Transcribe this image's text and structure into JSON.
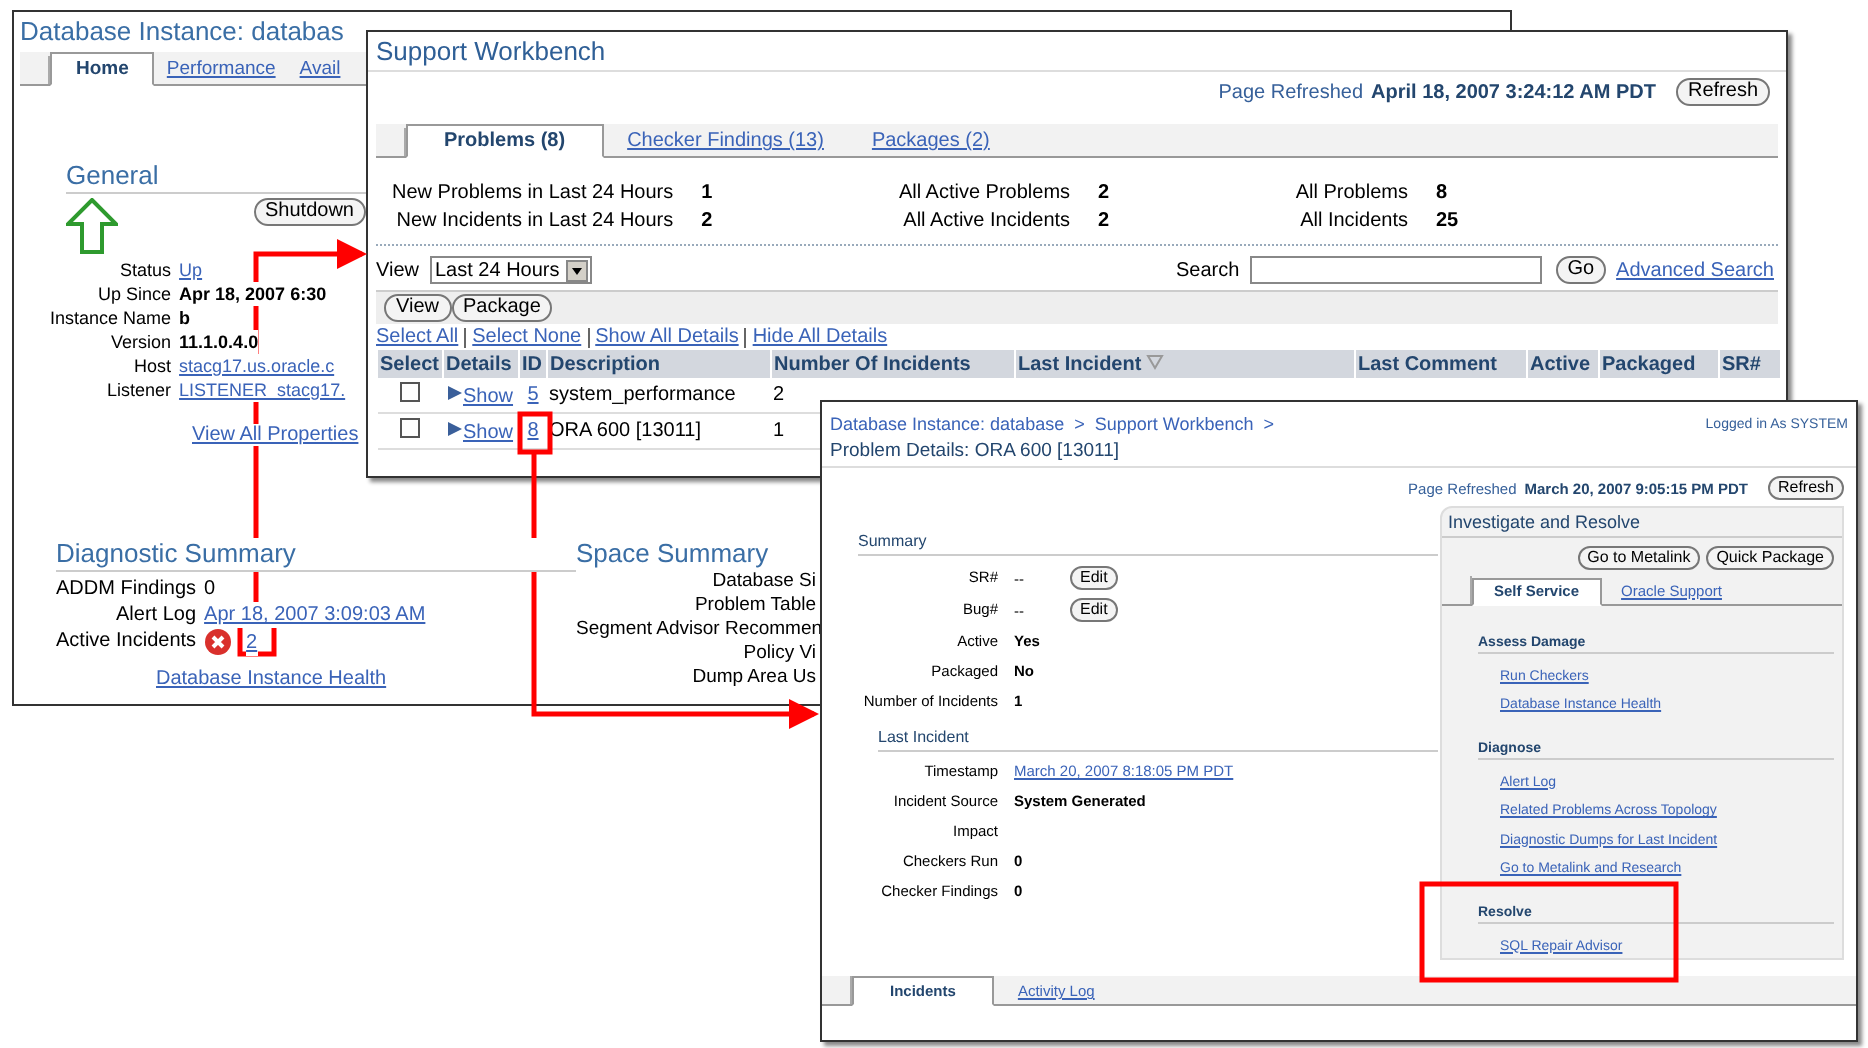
{
  "database_window": {
    "title": "Database Instance: databas",
    "tabs": [
      {
        "label": "Home",
        "selected": true
      },
      {
        "label": "Performance",
        "selected": false
      },
      {
        "label": "Avail",
        "selected": false
      }
    ],
    "general": {
      "heading": "General",
      "shutdown_button": "Shutdown",
      "properties": [
        {
          "label": "Status",
          "value": "Up",
          "kind": "link"
        },
        {
          "label": "Up Since",
          "value": "Apr 18, 2007 6:30",
          "kind": "bold"
        },
        {
          "label": "Instance Name",
          "value": "b",
          "kind": "bold"
        },
        {
          "label": "Version",
          "value": "11.1.0.4.0",
          "kind": "bold"
        },
        {
          "label": "Host",
          "value": "stacg17.us.oracle.c",
          "kind": "link"
        },
        {
          "label": "Listener",
          "value": "LISTENER_stacg17.",
          "kind": "link"
        }
      ],
      "view_all_link": "View All Properties"
    },
    "diagnostic_summary": {
      "heading": "Diagnostic Summary",
      "rows": [
        {
          "label": "ADDM Findings",
          "value": "0",
          "kind": "text",
          "error": false
        },
        {
          "label": "Alert Log",
          "value": "Apr 18, 2007 3:09:03 AM",
          "kind": "link",
          "error": false
        },
        {
          "label": "Active Incidents",
          "value": "2",
          "kind": "link",
          "error": true
        }
      ],
      "health_link": "Database Instance Health"
    },
    "space_summary": {
      "heading": "Space Summary",
      "labels": [
        "Database Si",
        "Problem Table",
        "Segment Advisor Recommen",
        "Policy Vi",
        "Dump Area Us"
      ]
    }
  },
  "workbench_window": {
    "title": "Support Workbench",
    "refreshed_label": "Page Refreshed",
    "refreshed_time": "April 18, 2007 3:24:12 AM PDT",
    "refresh_button": "Refresh",
    "tabs": [
      {
        "label": "Problems (8)",
        "selected": true
      },
      {
        "label": "Checker Findings (13)",
        "selected": false
      },
      {
        "label": "Packages (2)",
        "selected": false
      }
    ],
    "stats": [
      [
        {
          "label": "New Problems in Last 24 Hours",
          "value": "1"
        },
        {
          "label": "New Incidents in Last 24 Hours",
          "value": "2"
        }
      ],
      [
        {
          "label": "All Active Problems",
          "value": "2"
        },
        {
          "label": "All Active Incidents",
          "value": "2"
        }
      ],
      [
        {
          "label": "All Problems",
          "value": "8"
        },
        {
          "label": "All Incidents",
          "value": "25"
        }
      ]
    ],
    "view_label": "View",
    "view_select": "Last 24 Hours",
    "search_label": "Search",
    "go_button": "Go",
    "advanced_search_link": "Advanced Search",
    "action_buttons": [
      "View",
      "Package"
    ],
    "selection_links": [
      "Select All",
      "Select None",
      "Show All Details",
      "Hide All Details"
    ],
    "table": {
      "columns": [
        "Select",
        "Details",
        "ID",
        "Description",
        "Number Of Incidents",
        "Last Incident",
        "Last Comment",
        "Active",
        "Packaged",
        "SR#"
      ],
      "rows": [
        {
          "checked": false,
          "details": "Show",
          "id": "5",
          "description": "system_performance",
          "incidents": "2"
        },
        {
          "checked": false,
          "details": "Show",
          "id": "8",
          "description": "ORA 600 [13011]",
          "incidents": "1"
        }
      ]
    }
  },
  "problem_details_window": {
    "breadcrumb": [
      "Database Instance: database",
      ">",
      "Support Workbench",
      ">"
    ],
    "login": "Logged in As SYSTEM",
    "title": "Problem Details: ORA 600 [13011]",
    "refreshed_label": "Page Refreshed",
    "refreshed_time": "March 20, 2007 9:05:15 PM PDT",
    "refresh_button": "Refresh",
    "summary": {
      "heading": "Summary",
      "rows": [
        {
          "label": "SR#",
          "value": "--",
          "kind": "text",
          "button": "Edit"
        },
        {
          "label": "Bug#",
          "value": "--",
          "kind": "text",
          "button": "Edit"
        },
        {
          "label": "Active",
          "value": "Yes",
          "kind": "bold"
        },
        {
          "label": "Packaged",
          "value": "No",
          "kind": "bold"
        },
        {
          "label": "Number of Incidents",
          "value": "1",
          "kind": "bold"
        }
      ]
    },
    "last_incident": {
      "heading": "Last Incident",
      "rows": [
        {
          "label": "Timestamp",
          "value": "March 20, 2007 8:18:05 PM PDT",
          "kind": "link"
        },
        {
          "label": "Incident Source",
          "value": "System Generated",
          "kind": "bold"
        },
        {
          "label": "Impact"
        },
        {
          "label": "Checkers Run",
          "value": "0",
          "kind": "bold"
        },
        {
          "label": "Checker Findings",
          "value": "0",
          "kind": "bold"
        }
      ]
    },
    "panel": {
      "heading": "Investigate and Resolve",
      "buttons": [
        "Go to Metalink",
        "Quick Package"
      ],
      "tabs": [
        {
          "label": "Self Service",
          "selected": true
        },
        {
          "label": "Oracle Support",
          "selected": false
        }
      ],
      "sections": [
        {
          "heading": "Assess Damage",
          "links": [
            "Run Checkers",
            "Database Instance Health"
          ]
        },
        {
          "heading": "Diagnose",
          "links": [
            "Alert Log",
            "Related Problems Across Topology",
            "Diagnostic Dumps for Last Incident",
            "Go to Metalink and Research"
          ]
        },
        {
          "heading": "Resolve",
          "links": [
            "SQL Repair Advisor"
          ]
        }
      ]
    },
    "bottom_tabs": [
      {
        "label": "Incidents",
        "selected": true
      },
      {
        "label": "Activity Log",
        "selected": false
      }
    ]
  }
}
